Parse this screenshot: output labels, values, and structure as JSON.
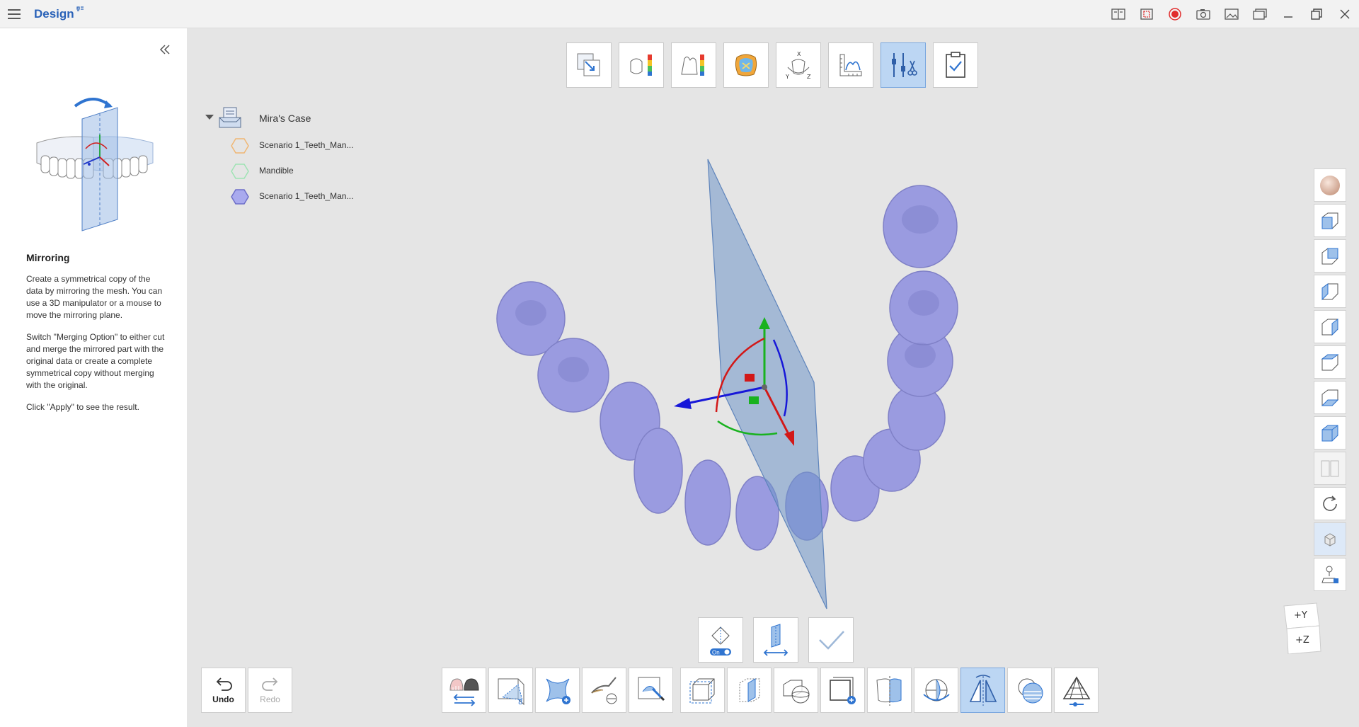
{
  "app": {
    "title": "Design"
  },
  "left_panel": {
    "title": "Mirroring",
    "paragraphs": [
      "Create a symmetrical copy of the data by mirroring the mesh. You can use a 3D manipulator or a mouse to move the mirroring plane.",
      "Switch \"Merging Option\" to either cut and merge the mirrored part with the original data or create a complete symmetrical copy without merging with the original.",
      "Click \"Apply\" to see the result."
    ]
  },
  "tree": {
    "case_name": "Mira's Case",
    "items": [
      {
        "label": "Scenario 1_Teeth_Man...",
        "color": "#f0b775",
        "filled": false
      },
      {
        "label": "Mandible",
        "color": "#9fe3b4",
        "filled": false
      },
      {
        "label": "Scenario 1_Teeth_Man...",
        "color": "#a9aaee",
        "filled": true
      }
    ]
  },
  "top_toolbar": {
    "buttons": [
      "transform-icon",
      "thickness-map-icon",
      "distance-map-icon",
      "crown-icon",
      "axis-orientation-icon",
      "ruler-icon",
      "adjust-tools-icon",
      "checklist-icon"
    ],
    "active_index": 6
  },
  "mid_actions": {
    "toggle_label": "On"
  },
  "undo": {
    "label": "Undo"
  },
  "redo": {
    "label": "Redo"
  },
  "axis_cube": {
    "y_label": "+Y",
    "z_label": "+Z"
  },
  "colors": {
    "accent": "#2a62b8",
    "teeth": "#9a9be0",
    "plane": "#6f95c9",
    "active_button": "#bcd6f3",
    "record": "#e12d2d"
  }
}
